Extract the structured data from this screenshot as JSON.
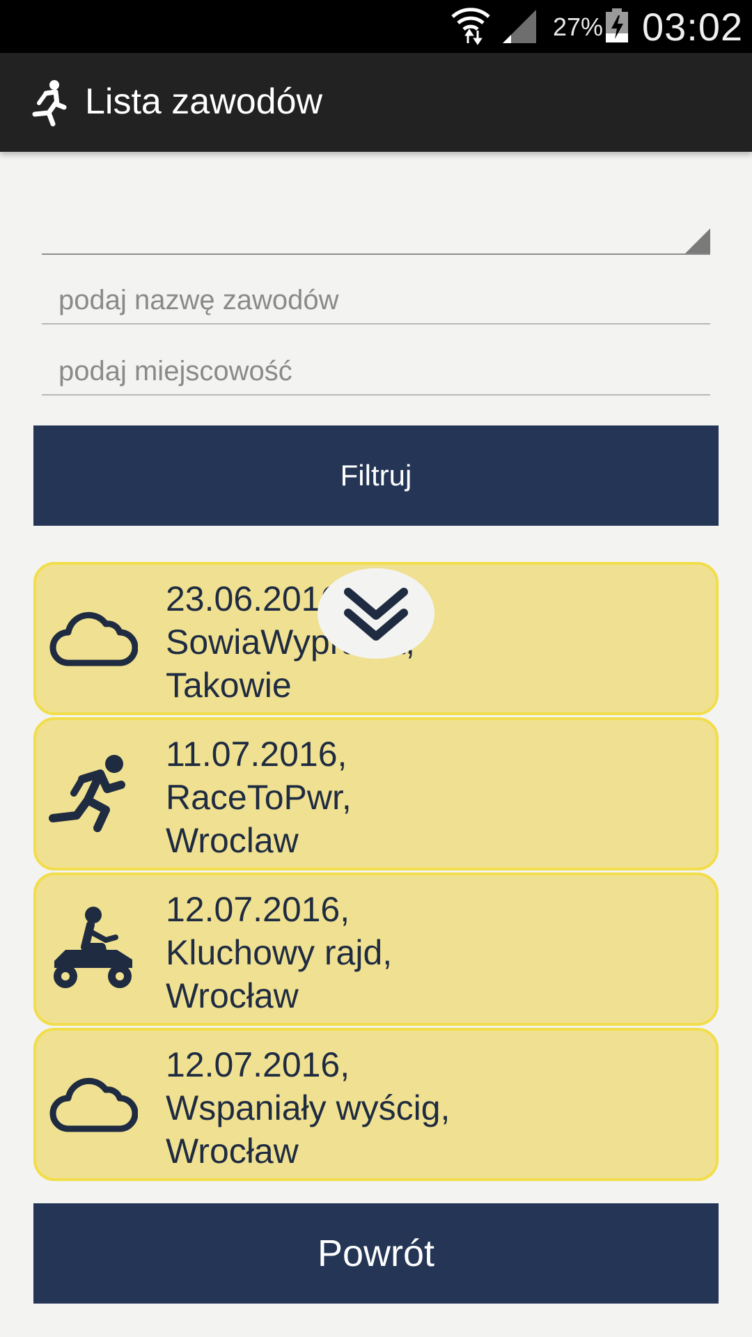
{
  "status_bar": {
    "battery_percent": "27%",
    "time": "03:02",
    "icons": [
      "wifi-icon",
      "signal-icon",
      "battery-charging-icon"
    ]
  },
  "app_bar": {
    "title": "Lista zawodów",
    "icon": "runner-icon"
  },
  "filters": {
    "category_value": "",
    "name_placeholder": "podaj nazwę zawodów",
    "city_placeholder": "podaj miejscowość",
    "filter_label": "Filtruj"
  },
  "events": [
    {
      "icon": "cloud-icon",
      "date": "23.06.2016,",
      "name": "SowiaWyprawa,",
      "city": "Takowie"
    },
    {
      "icon": "runner-icon",
      "date": "11.07.2016,",
      "name": "RaceToPwr,",
      "city": "Wroclaw"
    },
    {
      "icon": "quad-bike-icon",
      "date": "12.07.2016,",
      "name": "Kluchowy rajd,",
      "city": "Wrocław"
    },
    {
      "icon": "cloud-icon",
      "date": "12.07.2016,",
      "name": "Wspaniały wyścig,",
      "city": "Wrocław"
    }
  ],
  "scroll_indicator_icon": "chevron-double-down-icon",
  "back_label": "Powrót",
  "colors": {
    "app_bar": "#222222",
    "button": "#243556",
    "card_fill": "#f0e192",
    "card_border": "#f2dd4a",
    "card_text": "#1f2b40",
    "background": "#f3f3f1"
  }
}
